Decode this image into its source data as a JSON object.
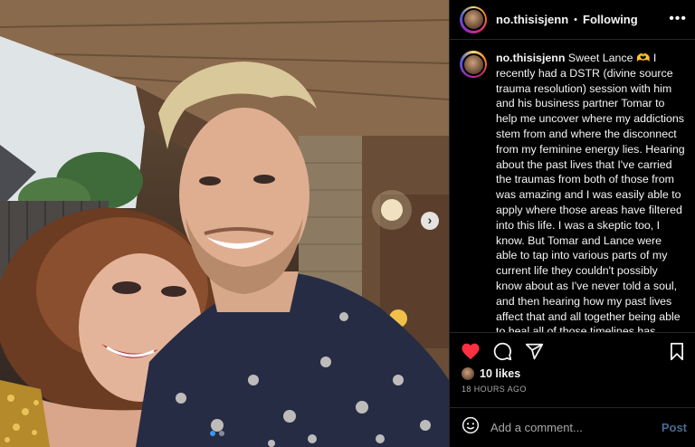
{
  "header": {
    "username": "no.thisisjenn",
    "separator": "•",
    "follow_status": "Following",
    "more_label": "•••"
  },
  "caption": {
    "username": "no.thisisjenn",
    "text": " Sweet Lance 🫶 I recently had a DSTR (divine source trauma resolution) session with him and his business partner Tomar to help me uncover where my addictions stem from and where the disconnect from my feminine energy lies. Hearing about the past lives that I've carried the traumas from both of those from was amazing and I was easily able to apply where those areas have filtered into this life. I was a skeptic too, I know. But Tomar and Lance were able to tap into various parts of my current life they couldn't possibly know about as I've never told a soul, and then hearing how my past lives affect that and all together being able to heal all of those timelines has taken a huge weight off of me. I have been able to"
  },
  "photo": {
    "next_label": "›",
    "slide_count": 2,
    "active_slide": 1
  },
  "actions": {
    "liked": true,
    "heart_color": "#ff3040",
    "icons": [
      "heart-icon",
      "comment-icon",
      "share-icon",
      "bookmark-icon"
    ]
  },
  "likes": "10 likes",
  "timestamp": "18 HOURS AGO",
  "comment": {
    "placeholder": "Add a comment...",
    "post_label": "Post"
  }
}
